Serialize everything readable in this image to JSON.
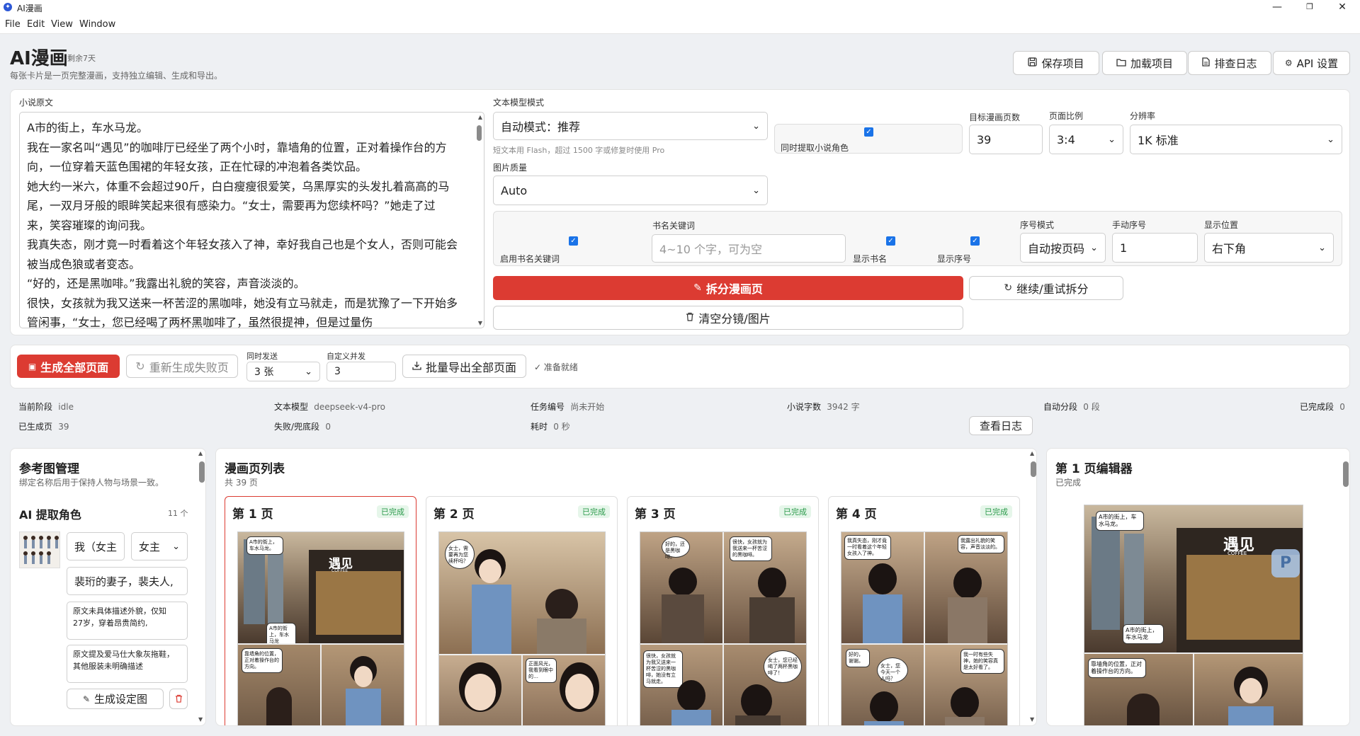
{
  "window": {
    "title": "AI漫画",
    "minimize": "—",
    "maximize": "❐",
    "close": "✕"
  },
  "menu": [
    "File",
    "Edit",
    "View",
    "Window"
  ],
  "header": {
    "title": "AI漫画",
    "badge": "剩余7天",
    "desc": "每张卡片是一页完整漫画，支持独立编辑、生成和导出。",
    "buttons": {
      "save": "保存项目",
      "load": "加载项目",
      "log": "排查日志",
      "api": "API 设置"
    }
  },
  "novel": {
    "label": "小说原文",
    "lines": [
      "A市的街上，车水马龙。",
      "我在一家名叫“遇见”的咖啡厅已经坐了两个小时，靠墙角的位置，正对着操作台的方",
      "向，一位穿着天蓝色围裙的年轻女孩，正在忙碌的冲泡着各类饮品。",
      "她大约一米六，体重不会超过90斤，白白瘦瘦很爱笑，乌黑厚实的头发扎着高高的马",
      "尾，一双月牙般的眼眸笑起来很有感染力。“女士，需要再为您续杯吗？”她走了过",
      "来，笑容璀璨的询问我。",
      "我真失态，刚才竟一时看着这个年轻女孩入了神，幸好我自己也是个女人，否则可能会",
      "被当成色狼或者变态。",
      "“好的，还是黑咖啡。”我露出礼貌的笑容，声音淡淡的。",
      "很快，女孩就为我又送来一杯苦涩的黑咖啡，她没有立马就走，而是犹豫了一下开始多",
      "管闲事，“女士，您已经喝了两杯黑咖啡了，虽然很提神，但是过量伤"
    ]
  },
  "settings": {
    "text_model_label": "文本模型模式",
    "text_model_value": "自动模式：推荐",
    "text_model_hint": "短文本用 Flash，超过 1500 字或修复时使用 Pro",
    "extract_chars_label": "同时提取小说角色",
    "target_pages_label": "目标漫画页数",
    "target_pages_value": "39",
    "ratio_label": "页面比例",
    "ratio_value": "3:4",
    "resolution_label": "分辨率",
    "resolution_value": "1K 标准",
    "image_quality_label": "图片质量",
    "image_quality_value": "Auto",
    "enable_book_keyword_label": "启用书名关键词",
    "book_keyword_label": "书名关键词",
    "book_keyword_placeholder": "4~10 个字，可为空",
    "show_book_label": "显示书名",
    "show_index_label": "显示序号",
    "index_mode_label": "序号模式",
    "index_mode_value": "自动按页码",
    "manual_index_label": "手动序号",
    "manual_index_value": "1",
    "position_label": "显示位置",
    "position_value": "右下角",
    "split_button": "拆分漫画页",
    "retry_split_button": "继续/重试拆分",
    "clear_button": "清空分镜/图片"
  },
  "actions": {
    "generate_all": "生成全部页面",
    "regenerate_failed": "重新生成失败页",
    "concurrent_label": "同时发送",
    "concurrent_value": "3 张",
    "custom_concurrent_label": "自定义并发",
    "custom_concurrent_value": "3",
    "export_all": "批量导出全部页面",
    "status": "准备就绪"
  },
  "stats": {
    "items": [
      {
        "label": "当前阶段",
        "value": "idle"
      },
      {
        "label": "文本模型",
        "value": "deepseek-v4-pro"
      },
      {
        "label": "任务编号",
        "value": "尚未开始"
      },
      {
        "label": "小说字数",
        "value": "3942 字"
      },
      {
        "label": "自动分段",
        "value": "0 段"
      },
      {
        "label": "已完成段",
        "value": "0"
      },
      {
        "label": "已生成页",
        "value": "39"
      },
      {
        "label": "失败/兜底段",
        "value": "0"
      },
      {
        "label": "耗时",
        "value": "0 秒"
      }
    ],
    "view_log": "查看日志"
  },
  "refs": {
    "title": "参考图管理",
    "desc": "绑定名称后用于保持人物与场景一致。",
    "ai_extract": "AI 提取角色",
    "count": "11 个",
    "char_name": "我（女主",
    "char_role": "女主",
    "char_desc": "裴珩的妻子，裴夫人,",
    "note1": "原文未具体描述外貌，仅知27岁，穿着昂贵简约,",
    "note2": "原文提及爱马仕大象灰拖鞋，其他服装未明确描述",
    "gen_button": "生成设定图"
  },
  "pages": {
    "title": "漫画页列表",
    "count": "共 39 页",
    "cards": [
      {
        "title": "第 1 页",
        "status": "已完成"
      },
      {
        "title": "第 2 页",
        "status": "已完成"
      },
      {
        "title": "第 3 页",
        "status": "已完成"
      },
      {
        "title": "第 4 页",
        "status": "已完成"
      }
    ]
  },
  "editor": {
    "title": "第 1 页编辑器",
    "status": "已完成"
  },
  "comic_text": {
    "p1_b1": "A市的街上，车水马龙。",
    "p1_b2": "A市的街上，车水马龙",
    "p1_b3": "靠墙角的位置，正对着操作台的方向。",
    "p1_b4": "遇见",
    "p1_sign": "遇见",
    "p2_b1": "女士，需要再为您续杯吗？",
    "p2_b2": "正面风光，我看到眼中的…",
    "p3_b1": "好的，还是黑咖啡。",
    "p3_b2": "很快，女孩就为我送来一杯苦涩的黑咖啡。",
    "p3_b3": "很快，女孩就为我又送来一杯苦涩的黑咖啡，她没有立马就走。",
    "p3_b4": "女士，您已经喝了两杯黑咖啡了！",
    "p4_b1": "我真失态，刚才竟一时看着这个年轻女孩入了神。",
    "p4_b2": "我露出礼貌的笑容，声音淡淡的。",
    "p4_b3": "好的，谢谢。",
    "p4_b4": "女士，您今天一个人吗？",
    "p4_b5": "我一时有些失神，她的笑容真是太好看了。",
    "ed_b1": "A市的街上，车水马龙。",
    "ed_b2": "A市的街上，车水马龙",
    "ed_b3": "靠墙角的位置，正对着操作台的方向。",
    "ed_sign": "遇见",
    "ed_sign_sub": "COFFEE",
    "p1_sign_sub": "COFFEE"
  }
}
